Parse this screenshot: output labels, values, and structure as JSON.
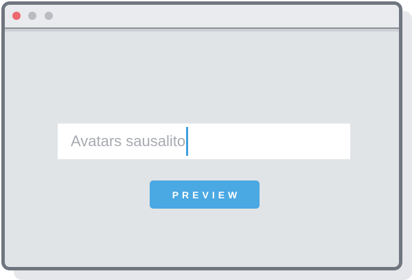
{
  "window": {
    "controls": [
      {
        "name": "close",
        "color": "#ec6a6f"
      },
      {
        "name": "minimize",
        "color": "#b9bcc1"
      },
      {
        "name": "zoom",
        "color": "#b9bcc1"
      }
    ]
  },
  "search": {
    "value": "Avatars sausalito",
    "caret_color": "#3f9fde"
  },
  "actions": {
    "preview_label": "PREVIEW",
    "preview_color": "#4aa8e3"
  }
}
